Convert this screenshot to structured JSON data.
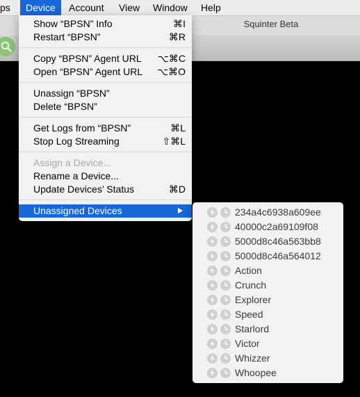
{
  "menubar": {
    "items": [
      "ps",
      "Device",
      "Account",
      "View",
      "Window",
      "Help"
    ]
  },
  "window": {
    "title": "Squinter Beta"
  },
  "device_menu": {
    "items": [
      {
        "label": "Show “BPSN” Info",
        "shortcut": "⌘I"
      },
      {
        "label": "Restart “BPSN”",
        "shortcut": "⌘R"
      },
      {
        "label": "Copy “BPSN” Agent URL",
        "shortcut": "⌥⌘C"
      },
      {
        "label": "Open “BPSN” Agent URL",
        "shortcut": "⌥⌘O"
      },
      {
        "label": "Unassign “BPSN”",
        "shortcut": ""
      },
      {
        "label": "Delete “BPSN”",
        "shortcut": ""
      },
      {
        "label": "Get Logs from “BPSN”",
        "shortcut": "⌘L"
      },
      {
        "label": "Stop Log Streaming",
        "shortcut": "⇧⌘L"
      },
      {
        "label": "Assign a Device...",
        "shortcut": ""
      },
      {
        "label": "Rename a Device...",
        "shortcut": ""
      },
      {
        "label": "Update Devices’ Status",
        "shortcut": "⌘D"
      },
      {
        "label": "Unassigned Devices",
        "shortcut": ""
      }
    ]
  },
  "submenu": {
    "devices": [
      "234a4c6938a609ee",
      "40000c2a69109f08",
      "5000d8c46a563bb8",
      "5000d8c46a564012",
      "Action",
      "Crunch",
      "Explorer",
      "Speed",
      "Starlord",
      "Victor",
      "Whizzer",
      "Whoopee"
    ]
  },
  "colors": {
    "highlight": "#1767d9",
    "menu_bg": "#f2f2f2",
    "disabled_text": "#a8a8a8",
    "status_icon": "#cfcfcf"
  },
  "icons": {
    "status_1": "power-bolt-icon",
    "status_2": "clock-icon",
    "submenu_arrow": "chevron-right-icon",
    "toolbar_search": "search-icon"
  }
}
